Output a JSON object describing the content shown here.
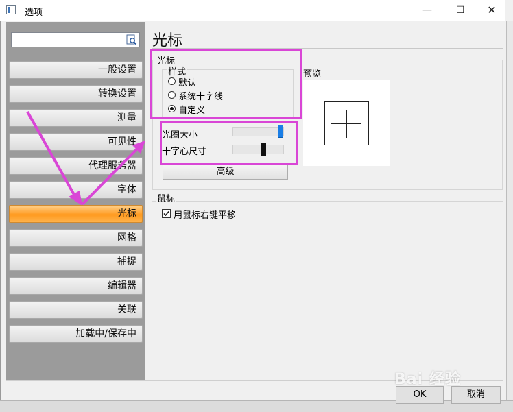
{
  "window": {
    "title": "选项",
    "controls": {
      "minimize": "—",
      "maximize": "☐",
      "close": "✕"
    }
  },
  "search": {
    "value": "",
    "placeholder": ""
  },
  "nav": {
    "items": [
      {
        "label": "一般设置",
        "active": false
      },
      {
        "label": "转换设置",
        "active": false
      },
      {
        "label": "测量",
        "active": false
      },
      {
        "label": "可见性",
        "active": false
      },
      {
        "label": "代理服务器",
        "active": false
      },
      {
        "label": "字体",
        "active": false
      },
      {
        "label": "光标",
        "active": true
      },
      {
        "label": "网格",
        "active": false
      },
      {
        "label": "捕捉",
        "active": false
      },
      {
        "label": "编辑器",
        "active": false
      },
      {
        "label": "关联",
        "active": false
      },
      {
        "label": "加载中/保存中",
        "active": false
      }
    ]
  },
  "page": {
    "title": "光标",
    "cursor_group": {
      "label": "光标",
      "style_label": "样式",
      "style_options": [
        "默认",
        "系统十字线",
        "自定义"
      ],
      "selected_style": "自定义",
      "pickbox_label": "光圈大小",
      "crosshair_label": "十字心尺寸",
      "advanced_label": "高级"
    },
    "preview_label": "预览",
    "mouse_group": {
      "label": "鼠标",
      "right_pan_label": "用鼠标右键平移",
      "right_pan_checked": true
    }
  },
  "footer": {
    "ok_label": "OK",
    "cancel_label": "取消"
  },
  "watermark": "Bai 经验",
  "colors": {
    "active_nav": "#ff9a1f",
    "annotation": "#d946d6",
    "slider_thumb": "#1a7ee6",
    "left_panel": "#9b9b9b"
  }
}
